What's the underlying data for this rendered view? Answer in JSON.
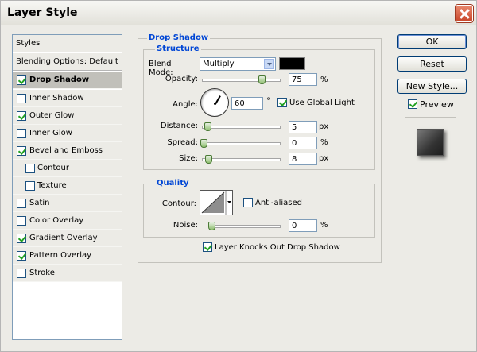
{
  "window": {
    "title": "Layer Style",
    "close_icon": "close-icon"
  },
  "styles_panel": {
    "header": "Styles",
    "blending_options": "Blending Options: Default",
    "items": [
      {
        "label": "Drop Shadow",
        "checked": true,
        "selected": true
      },
      {
        "label": "Inner Shadow",
        "checked": false
      },
      {
        "label": "Outer Glow",
        "checked": true
      },
      {
        "label": "Inner Glow",
        "checked": false
      },
      {
        "label": "Bevel and Emboss",
        "checked": true
      },
      {
        "label": "Contour",
        "checked": false
      },
      {
        "label": "Texture",
        "checked": false
      },
      {
        "label": "Satin",
        "checked": false
      },
      {
        "label": "Color Overlay",
        "checked": false
      },
      {
        "label": "Gradient Overlay",
        "checked": true
      },
      {
        "label": "Pattern Overlay",
        "checked": true
      },
      {
        "label": "Stroke",
        "checked": false
      }
    ]
  },
  "drop_shadow": {
    "title": "Drop Shadow",
    "structure": {
      "title": "Structure",
      "blend_mode_label": "Blend Mode:",
      "blend_mode_value": "Multiply",
      "shadow_color": "#000000",
      "opacity_label": "Opacity:",
      "opacity_value": "75",
      "opacity_unit": "%",
      "angle_label": "Angle:",
      "angle_value": "60",
      "angle_unit": "°",
      "use_global_light_label": "Use Global Light",
      "use_global_light_checked": true,
      "distance_label": "Distance:",
      "distance_value": "5",
      "distance_unit": "px",
      "spread_label": "Spread:",
      "spread_value": "0",
      "spread_unit": "%",
      "size_label": "Size:",
      "size_value": "8",
      "size_unit": "px"
    },
    "quality": {
      "title": "Quality",
      "contour_label": "Contour:",
      "anti_aliased_label": "Anti-aliased",
      "anti_aliased_checked": false,
      "noise_label": "Noise:",
      "noise_value": "0",
      "noise_unit": "%"
    },
    "knocks_out_label": "Layer Knocks Out Drop Shadow",
    "knocks_out_checked": true
  },
  "buttons": {
    "ok": "OK",
    "reset": "Reset",
    "new_style": "New Style...",
    "preview_label": "Preview",
    "preview_checked": true
  }
}
